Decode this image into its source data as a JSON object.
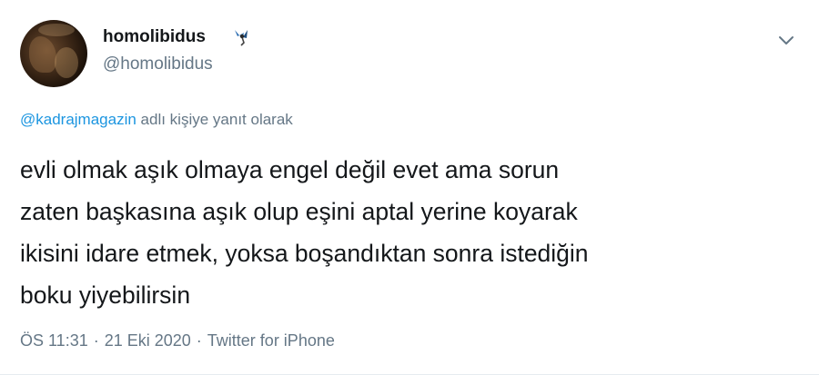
{
  "author": {
    "display_name": "homolibidus",
    "handle": "@homolibidus",
    "badge_icon": "bird-emoji-icon"
  },
  "menu": {
    "icon": "chevron-down-icon"
  },
  "reply": {
    "mention": "@kadrajmagazin",
    "text": " adlı kişiye yanıt olarak"
  },
  "tweet": {
    "lines": [
      "evli olmak aşık olmaya engel değil evet ama sorun",
      "zaten başkasına aşık olup eşini aptal yerine koyarak",
      "ikisini idare etmek, yoksa boşandıktan sonra istediğin",
      "boku yiyebilirsin"
    ]
  },
  "meta": {
    "time": "ÖS 11:31",
    "separator": "·",
    "date": "21 Eki 2020",
    "source": "Twitter for iPhone"
  },
  "colors": {
    "text": "#14171a",
    "secondary": "#657786",
    "link": "#1b95e0"
  }
}
